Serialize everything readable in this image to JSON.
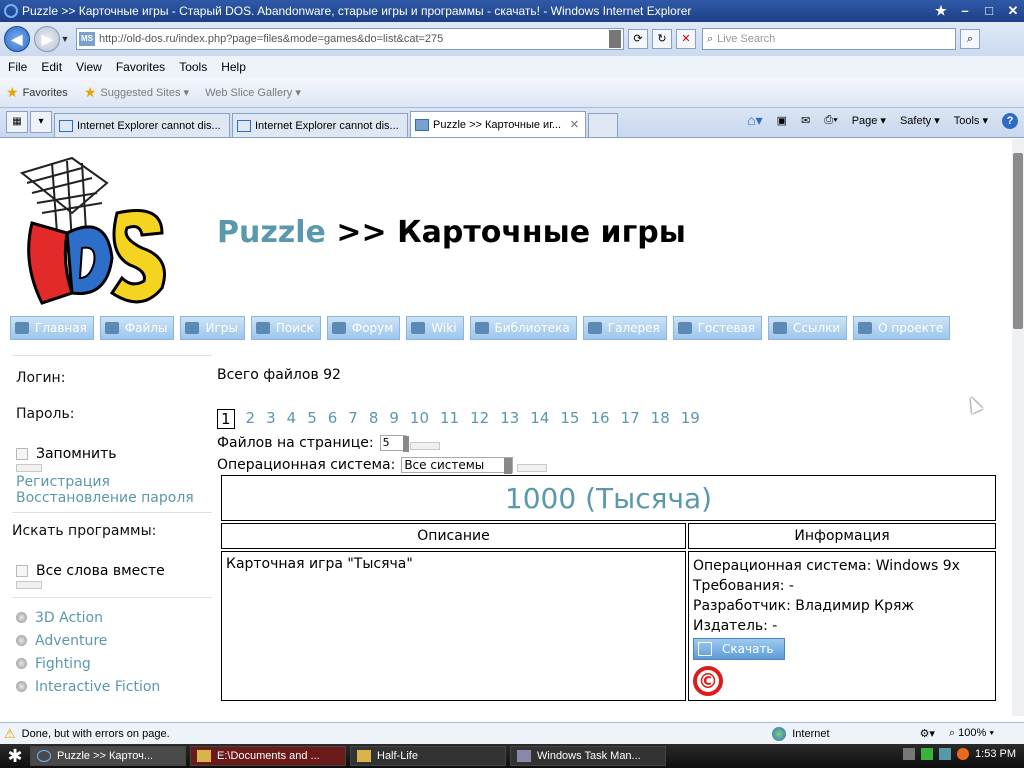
{
  "window": {
    "title": "Puzzle >> Карточные игры - Старый DOS. Abandonware, старые игры и программы - скачать! - Windows Internet Explorer"
  },
  "address": {
    "url": "http://old-dos.ru/index.php?page=files&mode=games&do=list&cat=275",
    "search_placeholder": "Live Search"
  },
  "menu": {
    "items": [
      "File",
      "Edit",
      "View",
      "Favorites",
      "Tools",
      "Help"
    ]
  },
  "favorites_bar": {
    "favorites_label": "Favorites",
    "suggested": "Suggested Sites ▾",
    "webslice": "Web Slice Gallery ▾"
  },
  "tabs": [
    {
      "label": "Internet Explorer cannot dis..."
    },
    {
      "label": "Internet Explorer cannot dis..."
    },
    {
      "label": "Puzzle >> Карточные иг..."
    }
  ],
  "command_bar": {
    "page": "Page ▾",
    "safety": "Safety ▾",
    "tools": "Tools ▾"
  },
  "site": {
    "heading_link": "Puzzle",
    "heading_rest": ">> Карточные игры",
    "logo_text": "MS DOS",
    "nav": [
      "Главная",
      "Файлы",
      "Игры",
      "Поиск",
      "Форум",
      "Wiki",
      "Библиотека",
      "Галерея",
      "Гостевая",
      "Ссылки",
      "О проекте"
    ]
  },
  "sidebar": {
    "login": "Логин:",
    "password": "Пароль:",
    "remember": "Запомнить",
    "register": "Регистрация",
    "restore": "Восстановление пароля",
    "search_label": "Искать программы:",
    "all_words": "Все слова вместе",
    "categories": [
      "3D Action",
      "Adventure",
      "Fighting",
      "Interactive Fiction"
    ]
  },
  "main": {
    "total": "Всего файлов 92",
    "pages": [
      "1",
      "2",
      "3",
      "4",
      "5",
      "6",
      "7",
      "8",
      "9",
      "10",
      "11",
      "12",
      "13",
      "14",
      "15",
      "16",
      "17",
      "18",
      "19"
    ],
    "current_page": "1",
    "per_page_label": "Файлов на странице:",
    "per_page_value": "5",
    "os_label": "Операционная система:",
    "os_value": "Все системы",
    "game_title": "1000 (Тысяча)",
    "col_desc": "Описание",
    "col_info": "Информация",
    "description": "Карточная игра \"Тысяча\"",
    "os": "Операционная система: Windows 9x",
    "requirements": "Требования: -",
    "developer": "Разработчик: Владимир Кряж",
    "publisher": "Издатель: -",
    "download": "Скачать",
    "copyright": "©"
  },
  "status": {
    "text": "Done, but with errors on page.",
    "zone": "Internet",
    "zoom": "100%"
  },
  "taskbar": {
    "items": [
      "Puzzle >> Карточ...",
      "E:\\Documents and ...",
      "Half-Life",
      "Windows Task Man..."
    ],
    "time": "1:53 PM"
  }
}
